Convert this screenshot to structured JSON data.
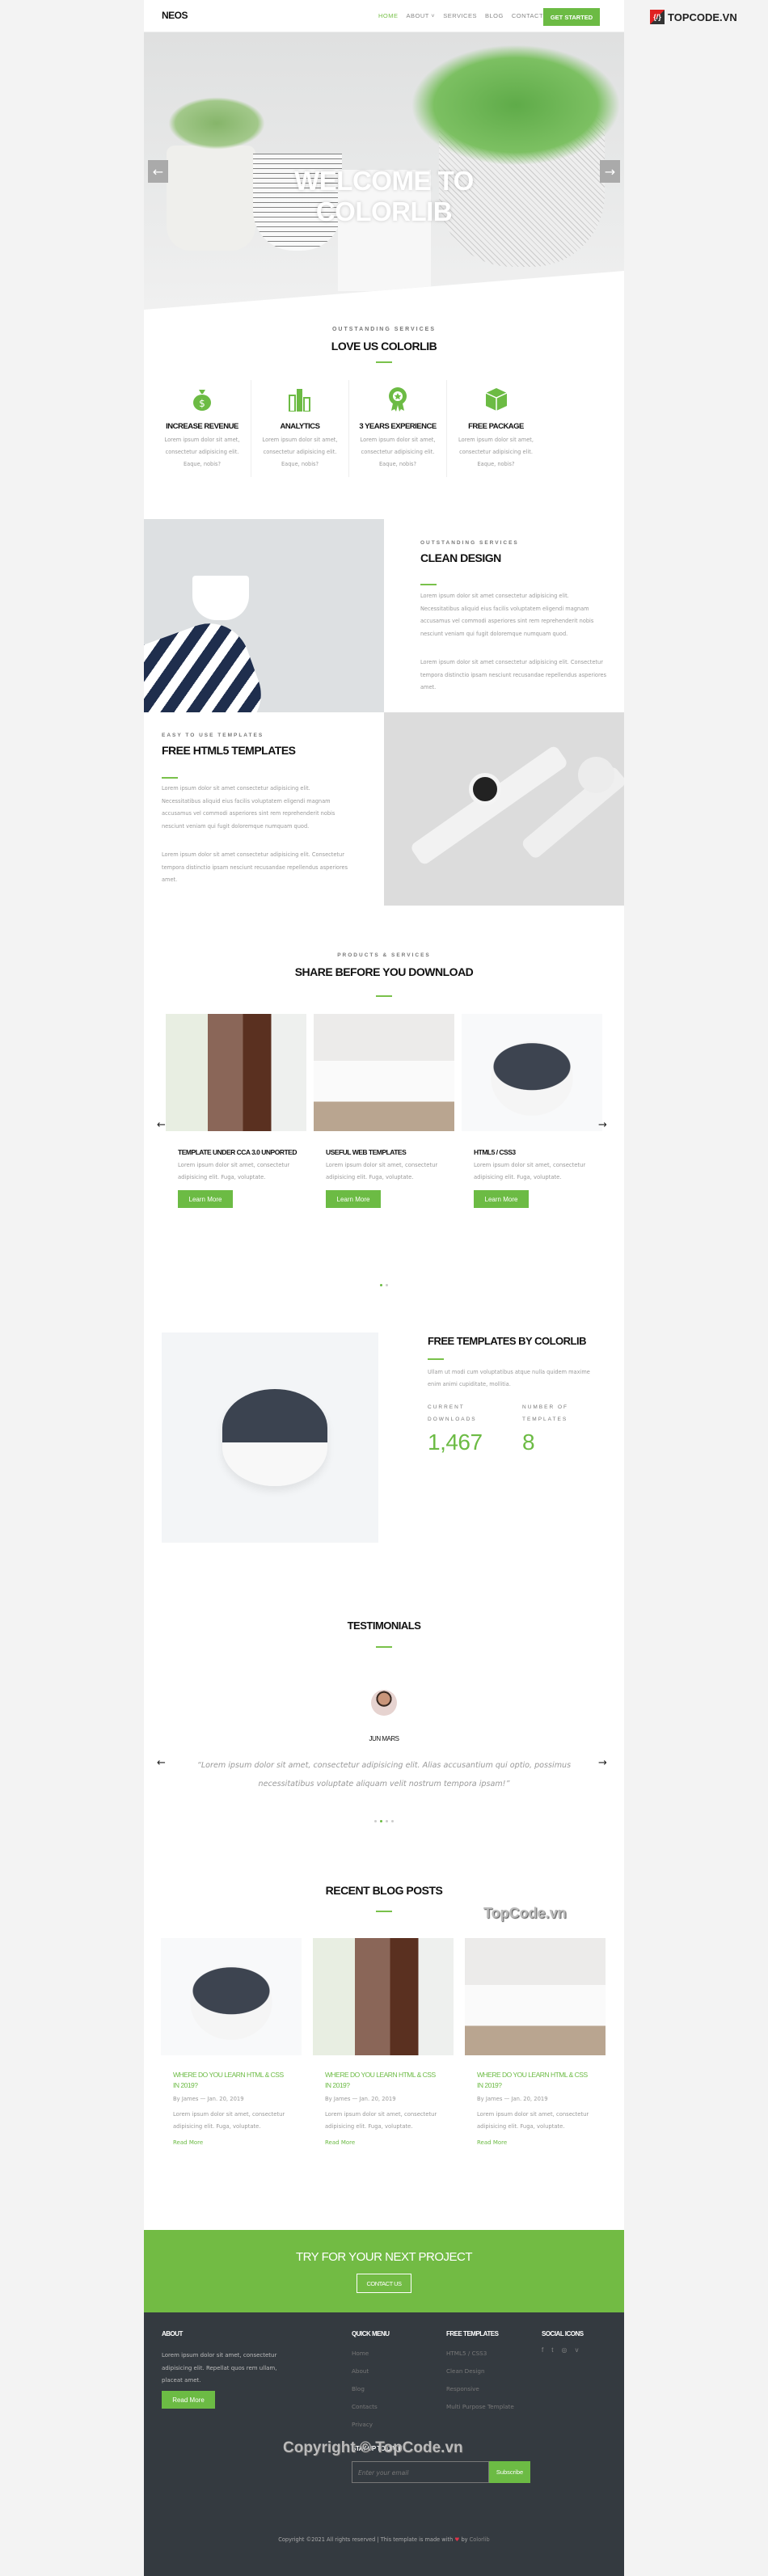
{
  "watermark": {
    "logo": "TOPCODE.VN",
    "blog": "TopCode.vn",
    "footer": "Copyright © TopCode.vn"
  },
  "colors": {
    "accent": "#6cbb44",
    "footer_bg": "#343a40"
  },
  "nav": {
    "logo": "NEOS",
    "items": [
      "HOME",
      "ABOUT",
      "SERVICES",
      "BLOG",
      "CONTACT"
    ],
    "active": "HOME",
    "cta": "GET STARTED"
  },
  "hero": {
    "title_line1": "WELCOME TO",
    "title_line2": "COLORLIB"
  },
  "services": {
    "subtitle": "OUTSTANDING SERVICES",
    "title": "LOVE US COLORLIB",
    "items": [
      {
        "icon": "money-bag-icon",
        "title": "INCREASE REVENUE",
        "text": "Lorem ipsum dolor sit amet, consectetur adipisicing elit. Eaque, nobis?"
      },
      {
        "icon": "bar-chart-icon",
        "title": "ANALYTICS",
        "text": "Lorem ipsum dolor sit amet, consectetur adipisicing elit. Eaque, nobis?"
      },
      {
        "icon": "award-icon",
        "title": "3 YEARS EXPERIENCE",
        "text": "Lorem ipsum dolor sit amet, consectetur adipisicing elit. Eaque, nobis?"
      },
      {
        "icon": "package-icon",
        "title": "FREE PACKAGE",
        "text": "Lorem ipsum dolor sit amet, consectetur adipisicing elit. Eaque, nobis?"
      }
    ]
  },
  "feature1": {
    "subtitle": "OUTSTANDING SERVICES",
    "title": "CLEAN DESIGN",
    "p1": "Lorem ipsum dolor sit amet consectetur adipisicing elit. Necessitatibus aliquid eius facilis voluptatem eligendi magnam accusamus vel commodi asperiores sint rem reprehenderit nobis nesciunt veniam qui fugit doloremque numquam quod.",
    "p2": "Lorem ipsum dolor sit amet consectetur adipisicing elit. Consectetur tempora distinctio ipsam nesciunt recusandae repellendus asperiores amet."
  },
  "feature2": {
    "subtitle": "EASY TO USE TEMPLATES",
    "title": "FREE HTML5 TEMPLATES",
    "p1": "Lorem ipsum dolor sit amet consectetur adipisicing elit. Necessitatibus aliquid eius facilis voluptatem eligendi magnam accusamus vel commodi asperiores sint rem reprehenderit nobis nesciunt veniam qui fugit doloremque numquam quod.",
    "p2": "Lorem ipsum dolor sit amet consectetur adipisicing elit. Consectetur tempora distinctio ipsam nesciunt recusandae repellendus asperiores amet."
  },
  "products": {
    "subtitle": "PRODUCTS & SERVICES",
    "title": "SHARE BEFORE YOU DOWNLOAD",
    "items": [
      {
        "title": "TEMPLATE UNDER CCA 3.0 UNPORTED",
        "text": "Lorem ipsum dolor sit amet, consectetur adipisicing elit. Fuga, voluptate.",
        "button": "Learn More"
      },
      {
        "title": "USEFUL WEB TEMPLATES",
        "text": "Lorem ipsum dolor sit amet, consectetur adipisicing elit. Fuga, voluptate.",
        "button": "Learn More"
      },
      {
        "title": "HTML5 / CSS3",
        "text": "Lorem ipsum dolor sit amet, consectetur adipisicing elit. Fuga, voluptate.",
        "button": "Learn More"
      }
    ]
  },
  "stats": {
    "title": "FREE TEMPLATES BY COLORLIB",
    "text": "Ullam ut modi cum voluptatibus atque nulla quidem maxime enim animi cupiditate, mollitia.",
    "items": [
      {
        "label": "CURRENT DOWNLOADS",
        "value": "1,467"
      },
      {
        "label": "NUMBER OF TEMPLATES",
        "value": "8"
      }
    ]
  },
  "testimonials": {
    "title": "TESTIMONIALS",
    "name": "Jun Mars",
    "quote": "“Lorem ipsum dolor sit amet, consectetur adipisicing elit. Alias accusantium qui optio, possimus necessitatibus voluptate aliquam velit nostrum tempora ipsam!”"
  },
  "blog": {
    "title": "RECENT BLOG POSTS",
    "posts": [
      {
        "title": "WHERE DO YOU LEARN HTML & CSS IN 2019?",
        "meta": "By James — Jan. 20, 2019",
        "text": "Lorem ipsum dolor sit amet, consectetur adipisicing elit. Fuga, voluptate.",
        "link": "Read More"
      },
      {
        "title": "WHERE DO YOU LEARN HTML & CSS IN 2019?",
        "meta": "By James — Jan. 20, 2019",
        "text": "Lorem ipsum dolor sit amet, consectetur adipisicing elit. Fuga, voluptate.",
        "link": "Read More"
      },
      {
        "title": "WHERE DO YOU LEARN HTML & CSS IN 2019?",
        "meta": "By James — Jan. 20, 2019",
        "text": "Lorem ipsum dolor sit amet, consectetur adipisicing elit. Fuga, voluptate.",
        "link": "Read More"
      }
    ]
  },
  "cta": {
    "title": "TRY FOR YOUR NEXT PROJECT",
    "button": "CONTACT US"
  },
  "footer": {
    "about_title": "ABOUT",
    "about_text": "Lorem ipsum dolor sit amet, consectetur adipisicing elit. Repellat quos rem ullam, placeat amet.",
    "about_button": "Read More",
    "quick_title": "QUICK MENU",
    "quick": [
      "Home",
      "About",
      "Blog",
      "Contacts",
      "Privacy"
    ],
    "templates_title": "FREE TEMPLATES",
    "templates": [
      "HTML5 / CSS3",
      "Clean Design",
      "Responsive",
      "Multi Purpose Template"
    ],
    "social_title": "SOCIAL ICONS",
    "social": [
      "facebook-icon",
      "twitter-icon",
      "instagram-icon",
      "vimeo-icon"
    ],
    "newsletter_title": "STAY UP TO DATE",
    "email_placeholder": "Enter your email",
    "subscribe": "Subscribe",
    "copyright_pre": "Copyright ©2021 All rights reserved | This template is made with",
    "copyright_by": "by",
    "copyright_brand": "Colorlib"
  }
}
